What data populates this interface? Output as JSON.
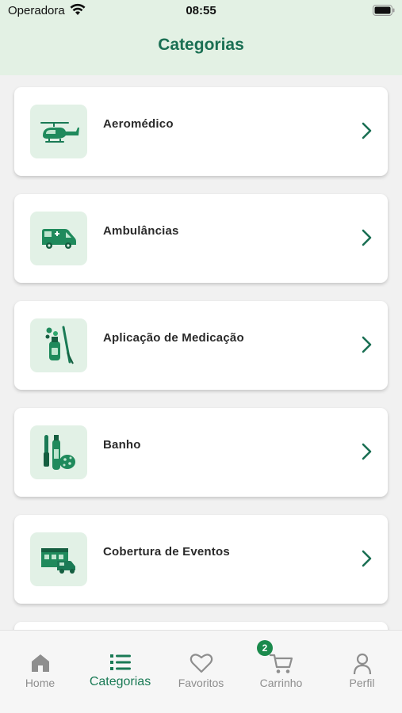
{
  "status": {
    "carrier": "Operadora",
    "time": "08:55"
  },
  "header": {
    "title": "Categorias"
  },
  "categories": [
    {
      "label": "Aeromédico",
      "icon": "helicopter-icon"
    },
    {
      "label": "Ambulâncias",
      "icon": "ambulance-icon"
    },
    {
      "label": "Aplicação de Medicação",
      "icon": "medication-icon"
    },
    {
      "label": "Banho",
      "icon": "bath-icon"
    },
    {
      "label": "Cobertura de Eventos",
      "icon": "event-coverage-icon"
    }
  ],
  "tabbar": {
    "items": [
      {
        "label": "Home",
        "icon": "home-icon",
        "active": false
      },
      {
        "label": "Categorias",
        "icon": "list-icon",
        "active": true
      },
      {
        "label": "Favoritos",
        "icon": "heart-icon",
        "active": false
      },
      {
        "label": "Carrinho",
        "icon": "cart-icon",
        "active": false,
        "badge": "2"
      },
      {
        "label": "Perfil",
        "icon": "person-icon",
        "active": false
      }
    ]
  },
  "colors": {
    "accent": "#1a6f53",
    "header_bg": "#e3f1e4",
    "icon_bg": "#e2f1e6",
    "badge": "#1b8a4c",
    "inactive": "#8e8e8e"
  }
}
